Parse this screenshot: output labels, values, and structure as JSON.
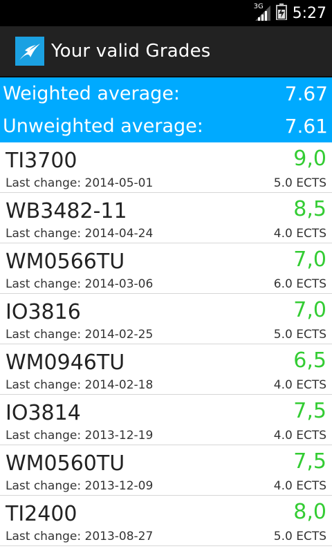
{
  "status_bar": {
    "network": "3G",
    "time": "5:27"
  },
  "action_bar": {
    "title": "Your valid Grades"
  },
  "summary": {
    "weighted_label": "Weighted average:",
    "weighted_value": "7.67",
    "unweighted_label": "Unweighted average:",
    "unweighted_value": "7.61"
  },
  "grades": [
    {
      "course": "TI3700",
      "grade": "9,0",
      "last_change": "Last change: 2014-05-01",
      "ects": "5.0 ECTS"
    },
    {
      "course": "WB3482-11",
      "grade": "8,5",
      "last_change": "Last change: 2014-04-24",
      "ects": "4.0 ECTS"
    },
    {
      "course": "WM0566TU",
      "grade": "7,0",
      "last_change": "Last change: 2014-03-06",
      "ects": "6.0 ECTS"
    },
    {
      "course": "IO3816",
      "grade": "7,0",
      "last_change": "Last change: 2014-02-25",
      "ects": "5.0 ECTS"
    },
    {
      "course": "WM0946TU",
      "grade": "6,5",
      "last_change": "Last change: 2014-02-18",
      "ects": "4.0 ECTS"
    },
    {
      "course": "IO3814",
      "grade": "7,5",
      "last_change": "Last change: 2013-12-19",
      "ects": "4.0 ECTS"
    },
    {
      "course": "WM0560TU",
      "grade": "7,5",
      "last_change": "Last change: 2013-12-09",
      "ects": "4.0 ECTS"
    },
    {
      "course": "TI2400",
      "grade": "8,0",
      "last_change": "Last change: 2013-08-27",
      "ects": "5.0 ECTS"
    }
  ],
  "colors": {
    "accent": "#00aaff",
    "grade_text": "#33cc33",
    "action_bar_bg": "#222222"
  }
}
